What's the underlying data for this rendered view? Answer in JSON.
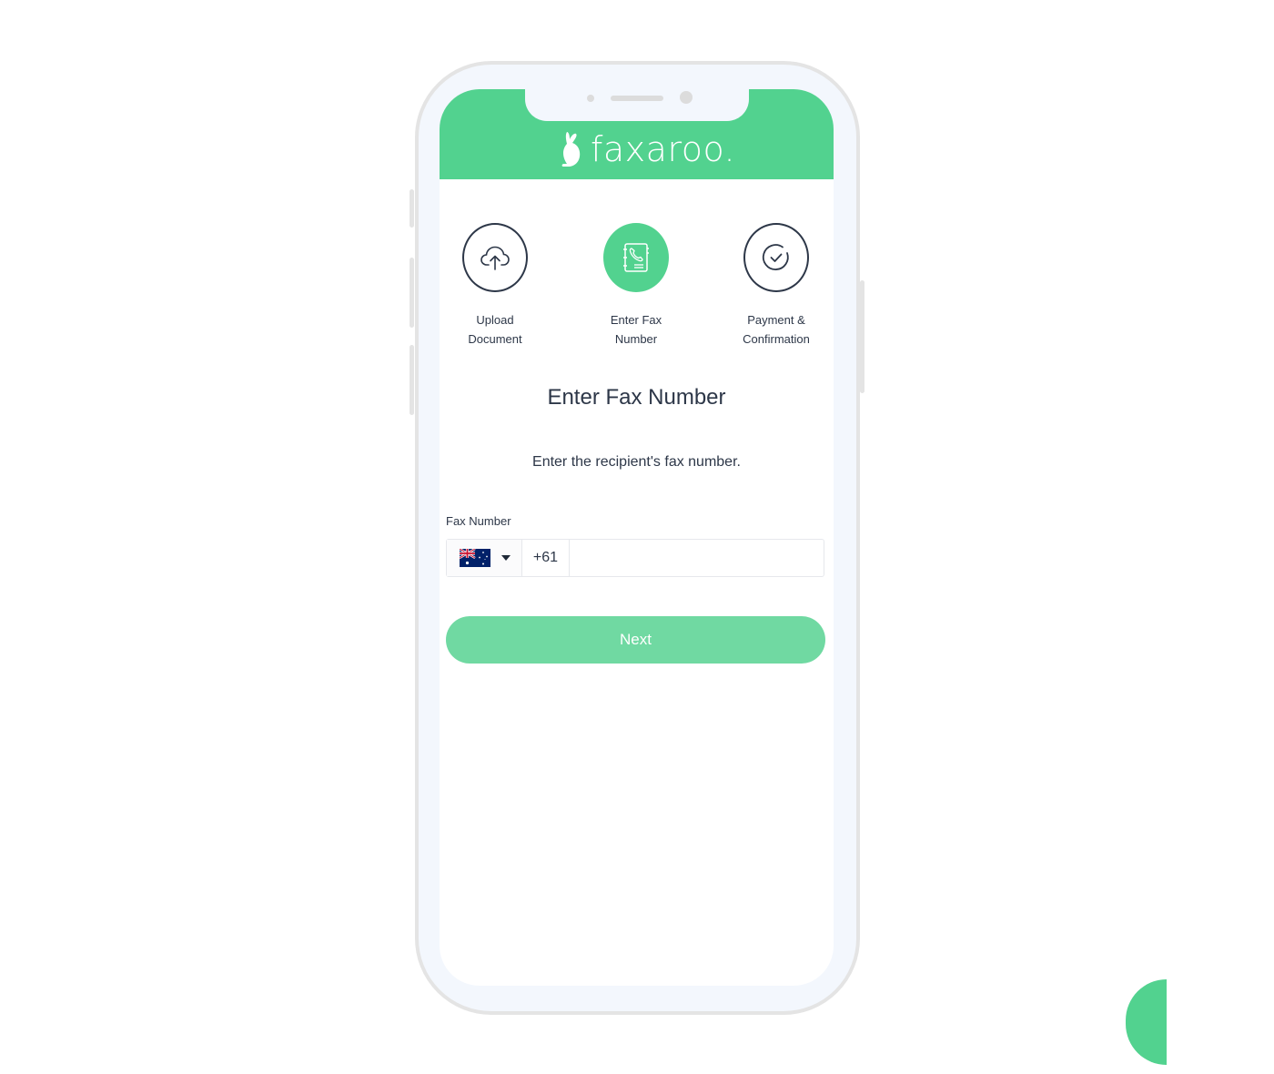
{
  "brand": {
    "name": "faxaroo.",
    "color": "#52d28f"
  },
  "steps": [
    {
      "label_line1": "Upload",
      "label_line2": "Document",
      "icon": "cloud-upload-icon",
      "active": false
    },
    {
      "label_line1": "Enter Fax",
      "label_line2": "Number",
      "icon": "phone-book-icon",
      "active": true
    },
    {
      "label_line1": "Payment &",
      "label_line2": "Confirmation",
      "icon": "check-circle-icon",
      "active": false
    }
  ],
  "page": {
    "title": "Enter Fax Number",
    "subtitle": "Enter the recipient's fax number."
  },
  "fax_field": {
    "label": "Fax Number",
    "country_flag": "australia-flag-icon",
    "dial_code": "+61",
    "value": "",
    "placeholder": ""
  },
  "actions": {
    "next_label": "Next"
  }
}
